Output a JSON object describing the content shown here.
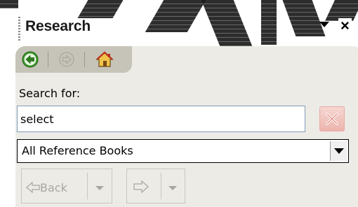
{
  "pane": {
    "title": "Research",
    "watermark_text": "PAINT"
  },
  "nav": {
    "back_icon": "green-back-arrow-icon",
    "forward_icon": "forward-arrow-icon",
    "home_icon": "home-icon"
  },
  "search": {
    "label": "Search for:",
    "value": "select",
    "clear_icon": "clear-x-icon"
  },
  "reference": {
    "selected": "All Reference Books"
  },
  "footer": {
    "back_label": "Back"
  },
  "colors": {
    "panel_bg": "#ecebe6",
    "tab_bg": "#c6c3b8",
    "clear_bg": "#ecb4ad",
    "disabled_text": "#a8a6a0"
  }
}
